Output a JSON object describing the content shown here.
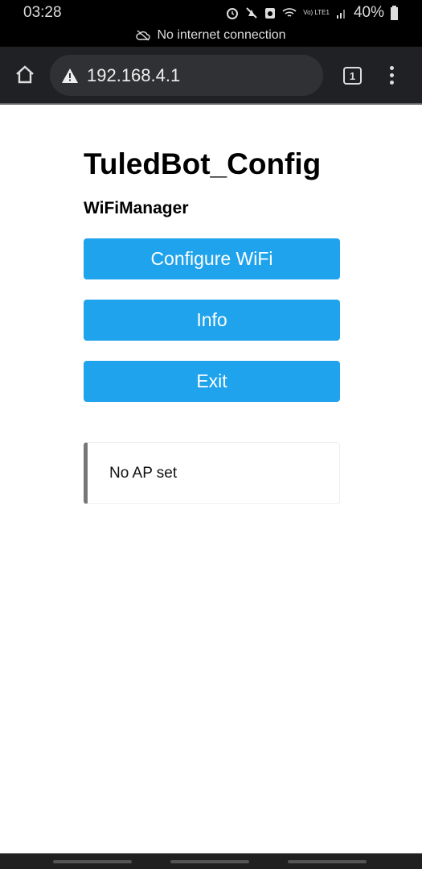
{
  "status_bar": {
    "time": "03:28",
    "battery": "40%",
    "network": "Vo) LTE1"
  },
  "banner": {
    "text": "No internet connection",
    "icon": "cloud-off-icon"
  },
  "browser": {
    "url": "192.168.4.1",
    "tab_count": "1"
  },
  "page": {
    "title": "TuledBot_Config",
    "subtitle": "WiFiManager",
    "buttons": [
      {
        "label": "Configure WiFi"
      },
      {
        "label": "Info"
      },
      {
        "label": "Exit"
      }
    ],
    "message": "No AP set"
  },
  "colors": {
    "button": "#1fa3ec",
    "toolbar": "#202124"
  }
}
